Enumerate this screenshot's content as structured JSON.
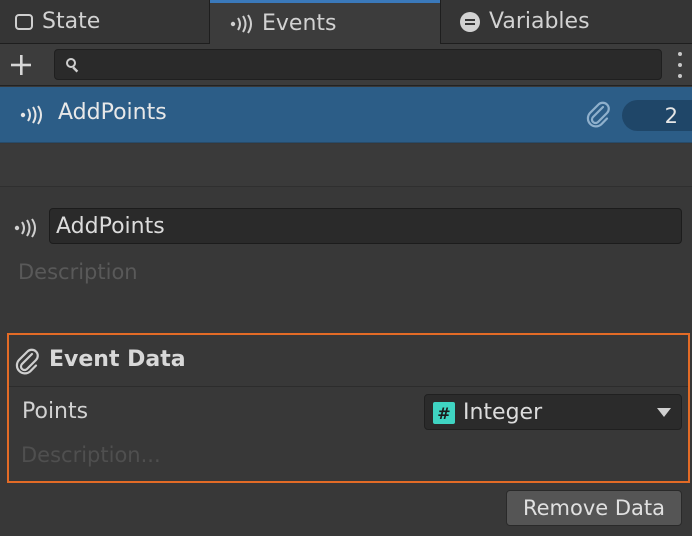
{
  "tabs": [
    {
      "label": "State",
      "icon": "square-outline-icon"
    },
    {
      "label": "Events",
      "icon": "broadcast-icon"
    },
    {
      "label": "Variables",
      "icon": "variables-icon"
    }
  ],
  "toolbar": {
    "add_icon": "plus-icon",
    "search_value": "",
    "search_placeholder": "",
    "menu_icon": "kebab-menu-icon"
  },
  "event_list": [
    {
      "label": "AddPoints",
      "icon": "broadcast-icon",
      "attachment_icon": "paperclip-icon",
      "count": "2",
      "selected": true
    }
  ],
  "event_detail": {
    "name": "AddPoints",
    "description_placeholder": "Description",
    "event_data": {
      "title": "Event Data",
      "param_label": "Points",
      "type_badge": "#",
      "type_value": "Integer",
      "description_placeholder": "Description..."
    },
    "remove_button": "Remove Data"
  },
  "colors": {
    "accent_blue": "#2c5d87",
    "highlight_orange": "#e36b26",
    "integer_badge": "#3fd4c2"
  }
}
